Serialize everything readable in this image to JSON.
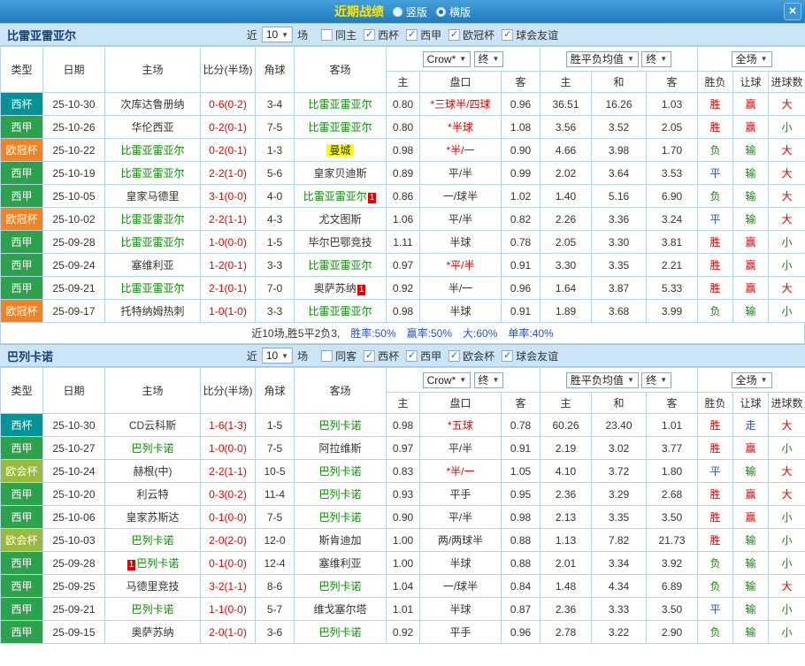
{
  "titlebar": {
    "title": "近期战绩",
    "layout_options": [
      {
        "label": "竖版",
        "selected": false
      },
      {
        "label": "横版",
        "selected": true
      }
    ],
    "close_icon": "×"
  },
  "columns": {
    "type": "类型",
    "date": "日期",
    "home": "主场",
    "score": "比分(半场)",
    "corner": "角球",
    "away": "客场",
    "odds_home": "主",
    "handicap": "盘口",
    "odds_away": "客",
    "avg_home": "主",
    "avg_draw": "和",
    "avg_away": "客",
    "result": "胜负",
    "let_ball": "让球",
    "goals": "进球数"
  },
  "filters": {
    "bookmaker": "Crow*",
    "final1": "终",
    "avg_label": "胜平负均值",
    "final2": "终",
    "scope": "全场"
  },
  "league_colors": {
    "cup": "#009499",
    "liga": "#2ba24c",
    "ucl": "#f58220",
    "uecl": "#9cb93f"
  },
  "sections": [
    {
      "team": "比雷亚雷亚尔",
      "near_label": "近",
      "games_count": "10",
      "games_label": "场",
      "checkboxes": [
        {
          "label": "同主",
          "checked": false
        },
        {
          "label": "西杯",
          "checked": true
        },
        {
          "label": "西甲",
          "checked": true
        },
        {
          "label": "欧冠杯",
          "checked": true
        },
        {
          "label": "球会友谊",
          "checked": true
        }
      ],
      "rows": [
        {
          "league": "西杯",
          "lcls": "cup",
          "date": "25-10-30",
          "home": {
            "name": "次库达鲁册纳",
            "cls": "",
            "badge": ""
          },
          "score": "0-6(0-2)",
          "corner": "3-4",
          "away": {
            "name": "比雷亚雷亚尔",
            "cls": "team",
            "badge": ""
          },
          "oh": "0.80",
          "hc": "*三球半/四球",
          "hc_red": true,
          "oa": "0.96",
          "ah": "36.51",
          "ad": "16.26",
          "aa": "1.03",
          "res": "胜",
          "res_cls": "red",
          "let": "赢",
          "let_cls": "red",
          "big": "大",
          "big_cls": "red"
        },
        {
          "league": "西甲",
          "lcls": "liga",
          "date": "25-10-26",
          "home": {
            "name": "华伦西亚",
            "cls": "",
            "badge": ""
          },
          "score": "0-2(0-1)",
          "corner": "7-5",
          "away": {
            "name": "比雷亚雷亚尔",
            "cls": "team",
            "badge": ""
          },
          "oh": "0.80",
          "hc": "*半球",
          "hc_red": true,
          "oa": "1.08",
          "ah": "3.56",
          "ad": "3.52",
          "aa": "2.05",
          "res": "胜",
          "res_cls": "red",
          "let": "赢",
          "let_cls": "red",
          "big": "小",
          "big_cls": "green"
        },
        {
          "league": "欧冠杯",
          "lcls": "ucl",
          "date": "25-10-22",
          "home": {
            "name": "比雷亚雷亚尔",
            "cls": "team",
            "badge": ""
          },
          "score": "0-2(0-1)",
          "corner": "1-3",
          "away": {
            "name": "曼城",
            "cls": "hl",
            "badge": ""
          },
          "oh": "0.98",
          "hc": "*半/一",
          "hc_red": true,
          "oa": "0.90",
          "ah": "4.66",
          "ad": "3.98",
          "aa": "1.70",
          "res": "负",
          "res_cls": "green",
          "let": "输",
          "let_cls": "green",
          "big": "大",
          "big_cls": "red"
        },
        {
          "league": "西甲",
          "lcls": "liga",
          "date": "25-10-19",
          "home": {
            "name": "比雷亚雷亚尔",
            "cls": "team",
            "badge": ""
          },
          "score": "2-2(1-0)",
          "corner": "5-6",
          "away": {
            "name": "皇家贝迪斯",
            "cls": "",
            "badge": ""
          },
          "oh": "0.89",
          "hc": "平/半",
          "hc_red": false,
          "oa": "0.99",
          "ah": "2.02",
          "ad": "3.64",
          "aa": "3.53",
          "res": "平",
          "res_cls": "blue",
          "let": "输",
          "let_cls": "green",
          "big": "大",
          "big_cls": "red"
        },
        {
          "league": "西甲",
          "lcls": "liga",
          "date": "25-10-05",
          "home": {
            "name": "皇家马德里",
            "cls": "",
            "badge": ""
          },
          "score": "3-1(0-0)",
          "corner": "4-0",
          "away": {
            "name": "比雷亚雷亚尔",
            "cls": "team",
            "badge": "1",
            "badge_pos": "after"
          },
          "oh": "0.86",
          "hc": "一/球半",
          "hc_red": false,
          "oa": "1.02",
          "ah": "1.40",
          "ad": "5.16",
          "aa": "6.90",
          "res": "负",
          "res_cls": "green",
          "let": "输",
          "let_cls": "green",
          "big": "大",
          "big_cls": "red"
        },
        {
          "league": "欧冠杯",
          "lcls": "ucl",
          "date": "25-10-02",
          "home": {
            "name": "比雷亚雷亚尔",
            "cls": "team",
            "badge": ""
          },
          "score": "2-2(1-1)",
          "corner": "4-3",
          "away": {
            "name": "尤文图斯",
            "cls": "",
            "badge": ""
          },
          "oh": "1.06",
          "hc": "平/半",
          "hc_red": false,
          "oa": "0.82",
          "ah": "2.26",
          "ad": "3.36",
          "aa": "3.24",
          "res": "平",
          "res_cls": "blue",
          "let": "输",
          "let_cls": "green",
          "big": "大",
          "big_cls": "red"
        },
        {
          "league": "西甲",
          "lcls": "liga",
          "date": "25-09-28",
          "home": {
            "name": "比雷亚雷亚尔",
            "cls": "team",
            "badge": ""
          },
          "score": "1-0(0-0)",
          "corner": "1-5",
          "away": {
            "name": "毕尔巴鄂竞技",
            "cls": "",
            "badge": ""
          },
          "oh": "1.11",
          "hc": "半球",
          "hc_red": false,
          "oa": "0.78",
          "ah": "2.05",
          "ad": "3.30",
          "aa": "3.81",
          "res": "胜",
          "res_cls": "red",
          "let": "赢",
          "let_cls": "red",
          "big": "小",
          "big_cls": "green"
        },
        {
          "league": "西甲",
          "lcls": "liga",
          "date": "25-09-24",
          "home": {
            "name": "塞维利亚",
            "cls": "",
            "badge": ""
          },
          "score": "1-2(0-1)",
          "corner": "3-3",
          "away": {
            "name": "比雷亚雷亚尔",
            "cls": "team",
            "badge": ""
          },
          "oh": "0.97",
          "hc": "*平/半",
          "hc_red": true,
          "oa": "0.91",
          "ah": "3.30",
          "ad": "3.35",
          "aa": "2.21",
          "res": "胜",
          "res_cls": "red",
          "let": "赢",
          "let_cls": "red",
          "big": "小",
          "big_cls": "green"
        },
        {
          "league": "西甲",
          "lcls": "liga",
          "date": "25-09-21",
          "home": {
            "name": "比雷亚雷亚尔",
            "cls": "team",
            "badge": ""
          },
          "score": "2-1(0-1)",
          "corner": "7-0",
          "away": {
            "name": "奥萨苏纳",
            "cls": "",
            "badge": "1",
            "badge_pos": "after"
          },
          "oh": "0.92",
          "hc": "半/一",
          "hc_red": false,
          "oa": "0.96",
          "ah": "1.64",
          "ad": "3.87",
          "aa": "5.33",
          "res": "胜",
          "res_cls": "red",
          "let": "赢",
          "let_cls": "red",
          "big": "大",
          "big_cls": "red"
        },
        {
          "league": "欧冠杯",
          "lcls": "ucl",
          "date": "25-09-17",
          "home": {
            "name": "托特纳姆热刺",
            "cls": "",
            "badge": ""
          },
          "score": "1-0(1-0)",
          "corner": "3-3",
          "away": {
            "name": "比雷亚雷亚尔",
            "cls": "team",
            "badge": ""
          },
          "oh": "0.98",
          "hc": "半球",
          "hc_red": false,
          "oa": "0.91",
          "ah": "1.89",
          "ad": "3.68",
          "aa": "3.99",
          "res": "负",
          "res_cls": "green",
          "let": "输",
          "let_cls": "green",
          "big": "小",
          "big_cls": "green"
        }
      ],
      "summary": {
        "prefix": "近10场,胜5平2负3,",
        "stat1": "胜率:50%",
        "stat2": "赢率:50%",
        "stat3": "大:60%",
        "stat4": "单率:40%"
      }
    },
    {
      "team": "巴列卡诺",
      "near_label": "近",
      "games_count": "10",
      "games_label": "场",
      "checkboxes": [
        {
          "label": "同客",
          "checked": false
        },
        {
          "label": "西杯",
          "checked": true
        },
        {
          "label": "西甲",
          "checked": true
        },
        {
          "label": "欧会杯",
          "checked": true
        },
        {
          "label": "球会友谊",
          "checked": true
        }
      ],
      "rows": [
        {
          "league": "西杯",
          "lcls": "cup",
          "date": "25-10-30",
          "home": {
            "name": "CD云科斯",
            "cls": "",
            "badge": ""
          },
          "score": "1-6(1-3)",
          "corner": "1-5",
          "away": {
            "name": "巴列卡诺",
            "cls": "team",
            "badge": ""
          },
          "oh": "0.98",
          "hc": "*五球",
          "hc_red": true,
          "oa": "0.78",
          "ah": "60.26",
          "ad": "23.40",
          "aa": "1.01",
          "res": "胜",
          "res_cls": "red",
          "let": "走",
          "let_cls": "blue",
          "big": "大",
          "big_cls": "red"
        },
        {
          "league": "西甲",
          "lcls": "liga",
          "date": "25-10-27",
          "home": {
            "name": "巴列卡诺",
            "cls": "team",
            "badge": ""
          },
          "score": "1-0(0-0)",
          "corner": "7-5",
          "away": {
            "name": "阿拉维斯",
            "cls": "",
            "badge": ""
          },
          "oh": "0.97",
          "hc": "平/半",
          "hc_red": false,
          "oa": "0.91",
          "ah": "2.19",
          "ad": "3.02",
          "aa": "3.77",
          "res": "胜",
          "res_cls": "red",
          "let": "赢",
          "let_cls": "red",
          "big": "小",
          "big_cls": "green"
        },
        {
          "league": "欧会杯",
          "lcls": "uecl",
          "date": "25-10-24",
          "home": {
            "name": "赫根(中)",
            "cls": "",
            "badge": ""
          },
          "score": "2-2(1-1)",
          "corner": "10-5",
          "away": {
            "name": "巴列卡诺",
            "cls": "team",
            "badge": ""
          },
          "oh": "0.83",
          "hc": "*半/一",
          "hc_red": true,
          "oa": "1.05",
          "ah": "4.10",
          "ad": "3.72",
          "aa": "1.80",
          "res": "平",
          "res_cls": "blue",
          "let": "输",
          "let_cls": "green",
          "big": "大",
          "big_cls": "red"
        },
        {
          "league": "西甲",
          "lcls": "liga",
          "date": "25-10-20",
          "home": {
            "name": "利云特",
            "cls": "",
            "badge": ""
          },
          "score": "0-3(0-2)",
          "corner": "11-4",
          "away": {
            "name": "巴列卡诺",
            "cls": "team",
            "badge": ""
          },
          "oh": "0.93",
          "hc": "平手",
          "hc_red": false,
          "oa": "0.95",
          "ah": "2.36",
          "ad": "3.29",
          "aa": "2.68",
          "res": "胜",
          "res_cls": "red",
          "let": "赢",
          "let_cls": "red",
          "big": "大",
          "big_cls": "red"
        },
        {
          "league": "西甲",
          "lcls": "liga",
          "date": "25-10-06",
          "home": {
            "name": "皇家苏斯达",
            "cls": "",
            "badge": ""
          },
          "score": "0-1(0-0)",
          "corner": "7-5",
          "away": {
            "name": "巴列卡诺",
            "cls": "team",
            "badge": ""
          },
          "oh": "0.90",
          "hc": "平/半",
          "hc_red": false,
          "oa": "0.98",
          "ah": "2.13",
          "ad": "3.35",
          "aa": "3.50",
          "res": "胜",
          "res_cls": "red",
          "let": "赢",
          "let_cls": "red",
          "big": "小",
          "big_cls": "green"
        },
        {
          "league": "欧会杯",
          "lcls": "uecl",
          "date": "25-10-03",
          "home": {
            "name": "巴列卡诺",
            "cls": "team",
            "badge": ""
          },
          "score": "2-0(2-0)",
          "corner": "12-0",
          "away": {
            "name": "斯肯迪加",
            "cls": "",
            "badge": ""
          },
          "oh": "1.00",
          "hc": "两/两球半",
          "hc_red": false,
          "oa": "0.88",
          "ah": "1.13",
          "ad": "7.82",
          "aa": "21.73",
          "res": "胜",
          "res_cls": "red",
          "let": "输",
          "let_cls": "green",
          "big": "小",
          "big_cls": "green"
        },
        {
          "league": "西甲",
          "lcls": "liga",
          "date": "25-09-28",
          "home": {
            "name": "巴列卡诺",
            "cls": "team",
            "badge": "1",
            "badge_pos": "before"
          },
          "score": "0-1(0-0)",
          "corner": "12-4",
          "away": {
            "name": "塞维利亚",
            "cls": "",
            "badge": ""
          },
          "oh": "1.00",
          "hc": "半球",
          "hc_red": false,
          "oa": "0.88",
          "ah": "2.01",
          "ad": "3.34",
          "aa": "3.92",
          "res": "负",
          "res_cls": "green",
          "let": "输",
          "let_cls": "green",
          "big": "小",
          "big_cls": "green"
        },
        {
          "league": "西甲",
          "lcls": "liga",
          "date": "25-09-25",
          "home": {
            "name": "马德里竞技",
            "cls": "",
            "badge": ""
          },
          "score": "3-2(1-1)",
          "corner": "8-6",
          "away": {
            "name": "巴列卡诺",
            "cls": "team",
            "badge": ""
          },
          "oh": "1.04",
          "hc": "一/球半",
          "hc_red": false,
          "oa": "0.84",
          "ah": "1.48",
          "ad": "4.34",
          "aa": "6.89",
          "res": "负",
          "res_cls": "green",
          "let": "输",
          "let_cls": "green",
          "big": "大",
          "big_cls": "red"
        },
        {
          "league": "西甲",
          "lcls": "liga",
          "date": "25-09-21",
          "home": {
            "name": "巴列卡诺",
            "cls": "team",
            "badge": ""
          },
          "score": "1-1(0-0)",
          "corner": "5-7",
          "away": {
            "name": "维戈塞尔塔",
            "cls": "",
            "badge": ""
          },
          "oh": "1.01",
          "hc": "半球",
          "hc_red": false,
          "oa": "0.87",
          "ah": "2.36",
          "ad": "3.33",
          "aa": "3.50",
          "res": "平",
          "res_cls": "blue",
          "let": "输",
          "let_cls": "green",
          "big": "小",
          "big_cls": "green"
        },
        {
          "league": "西甲",
          "lcls": "liga",
          "date": "25-09-15",
          "home": {
            "name": "奥萨苏纳",
            "cls": "",
            "badge": ""
          },
          "score": "2-0(1-0)",
          "corner": "3-6",
          "away": {
            "name": "巴列卡诺",
            "cls": "team",
            "badge": ""
          },
          "oh": "0.92",
          "hc": "平手",
          "hc_red": false,
          "oa": "0.96",
          "ah": "2.78",
          "ad": "3.22",
          "aa": "2.90",
          "res": "负",
          "res_cls": "green",
          "let": "输",
          "let_cls": "green",
          "big": "小",
          "big_cls": "green"
        }
      ]
    }
  ]
}
